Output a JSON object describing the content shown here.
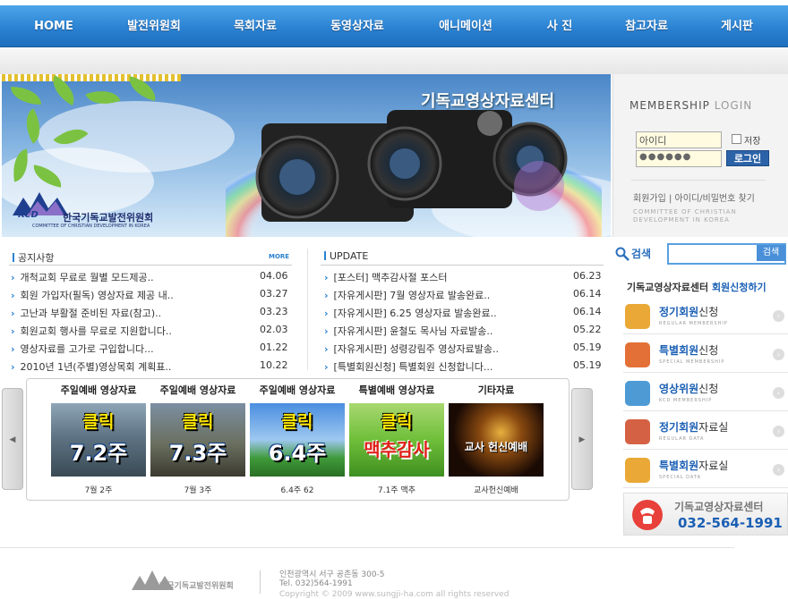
{
  "nav": {
    "items": [
      "HOME",
      "발전위원회",
      "목회자료",
      "동영상자료",
      "애니메이션",
      "사 진",
      "참고자료",
      "게시판"
    ]
  },
  "hero": {
    "title": "기독교영상자료센터",
    "logo_name": "한국기독교발전위원회",
    "logo_sub": "COMMITTEE OF CHRISTIAN DEVELOPMENT IN KOREA",
    "logo_mark": "KCD"
  },
  "login": {
    "title_a": "MEMBERSHIP",
    "title_b": "LOGIN",
    "id_placeholder": "아이디",
    "pw_value": "●●●●●●",
    "save_label": "저장",
    "login_button": "로그인",
    "links": "회원가입 | 아이디/비밀번호 찾기",
    "sub1": "COMMITTEE OF CHRISTIAN",
    "sub2": "DEVELOPMENT IN KOREA"
  },
  "notice": {
    "title": "공지사항",
    "more": "MORE",
    "items": [
      {
        "text": "개척교회 무료로 월별 모드제공..",
        "date": "04.06"
      },
      {
        "text": "회원 가입자(필독) 영상자료 제공 내..",
        "date": "03.27"
      },
      {
        "text": "고난과 부활절 준비된 자료(참고)..",
        "date": "03.23"
      },
      {
        "text": "회원교회 행사를 무료로 지원합니다..",
        "date": "02.03"
      },
      {
        "text": "영상자료를 고가로 구입합니다...",
        "date": "01.22"
      },
      {
        "text": "2010년 1년(주별)영상목회 계획표..",
        "date": "10.22"
      }
    ]
  },
  "update": {
    "title": "UPDATE",
    "items": [
      {
        "text": "[포스터] 맥추감사절 포스터",
        "date": "06.23"
      },
      {
        "text": "[자유게시판] 7월 영상자료 발송완료..",
        "date": "06.14"
      },
      {
        "text": "[자유게시판] 6.25 영상자료 발송완료..",
        "date": "06.14"
      },
      {
        "text": "[자유게시판] 윤철도 목사님 자료발송..",
        "date": "05.22"
      },
      {
        "text": "[자유게시판] 성령강림주 영상자료발송..",
        "date": "05.19"
      },
      {
        "text": "[특별회원신청] 특별회원 신청합니다...",
        "date": "05.19"
      }
    ]
  },
  "gallery": {
    "prev": "◀",
    "next": "▶",
    "items": [
      {
        "category": "주일예배 영상자료",
        "t1": "클릭",
        "t2": "7.2주",
        "caption": "7월 2주"
      },
      {
        "category": "주일예배 영상자료",
        "t1": "클릭",
        "t2": "7.3주",
        "caption": "7월 3주"
      },
      {
        "category": "주일예배 영상자료",
        "t1": "클릭",
        "t2": "6.4주",
        "caption": "6.4주 62"
      },
      {
        "category": "특별예배 영상자료",
        "t1": "클릭",
        "t2": "맥추감사",
        "caption": "7.1주 맥추"
      },
      {
        "category": "기타자료",
        "t1": "",
        "t2": "교사 헌신예배",
        "caption": "교사헌신예배"
      }
    ]
  },
  "search": {
    "label": "검색",
    "button": "검색"
  },
  "side": {
    "head_a": "기독교영상자료센터",
    "head_b": "회원신청하기",
    "items": [
      {
        "main": "정기회원",
        "suffix": "신청",
        "sub": "REGULAR MEMBERSHIP"
      },
      {
        "main": "특별회원",
        "suffix": "신청",
        "sub": "SPECIAL MEMBERSHIP"
      },
      {
        "main": "영상위원",
        "suffix": "신청",
        "sub": "KCD MEMBERSHIP"
      },
      {
        "main": "정기회원",
        "suffix": "자료실",
        "sub": "REGULAR DATA"
      },
      {
        "main": "특별회원",
        "suffix": "자료실",
        "sub": "SPECIAL DATA"
      }
    ],
    "phone_label": "기독교영상자료센터",
    "phone_number": "032-564-1991"
  },
  "footer": {
    "address": "인천광역시 서구 공촌동 300-5",
    "tel": "Tel. 032)564-1991",
    "copyright": "Copyright © 2009 www.sungji-ha.com all rights reserved"
  },
  "colors": {
    "nav": "#2b82d2",
    "accent": "#1a5fb4",
    "phone": "#1a5fb4"
  }
}
